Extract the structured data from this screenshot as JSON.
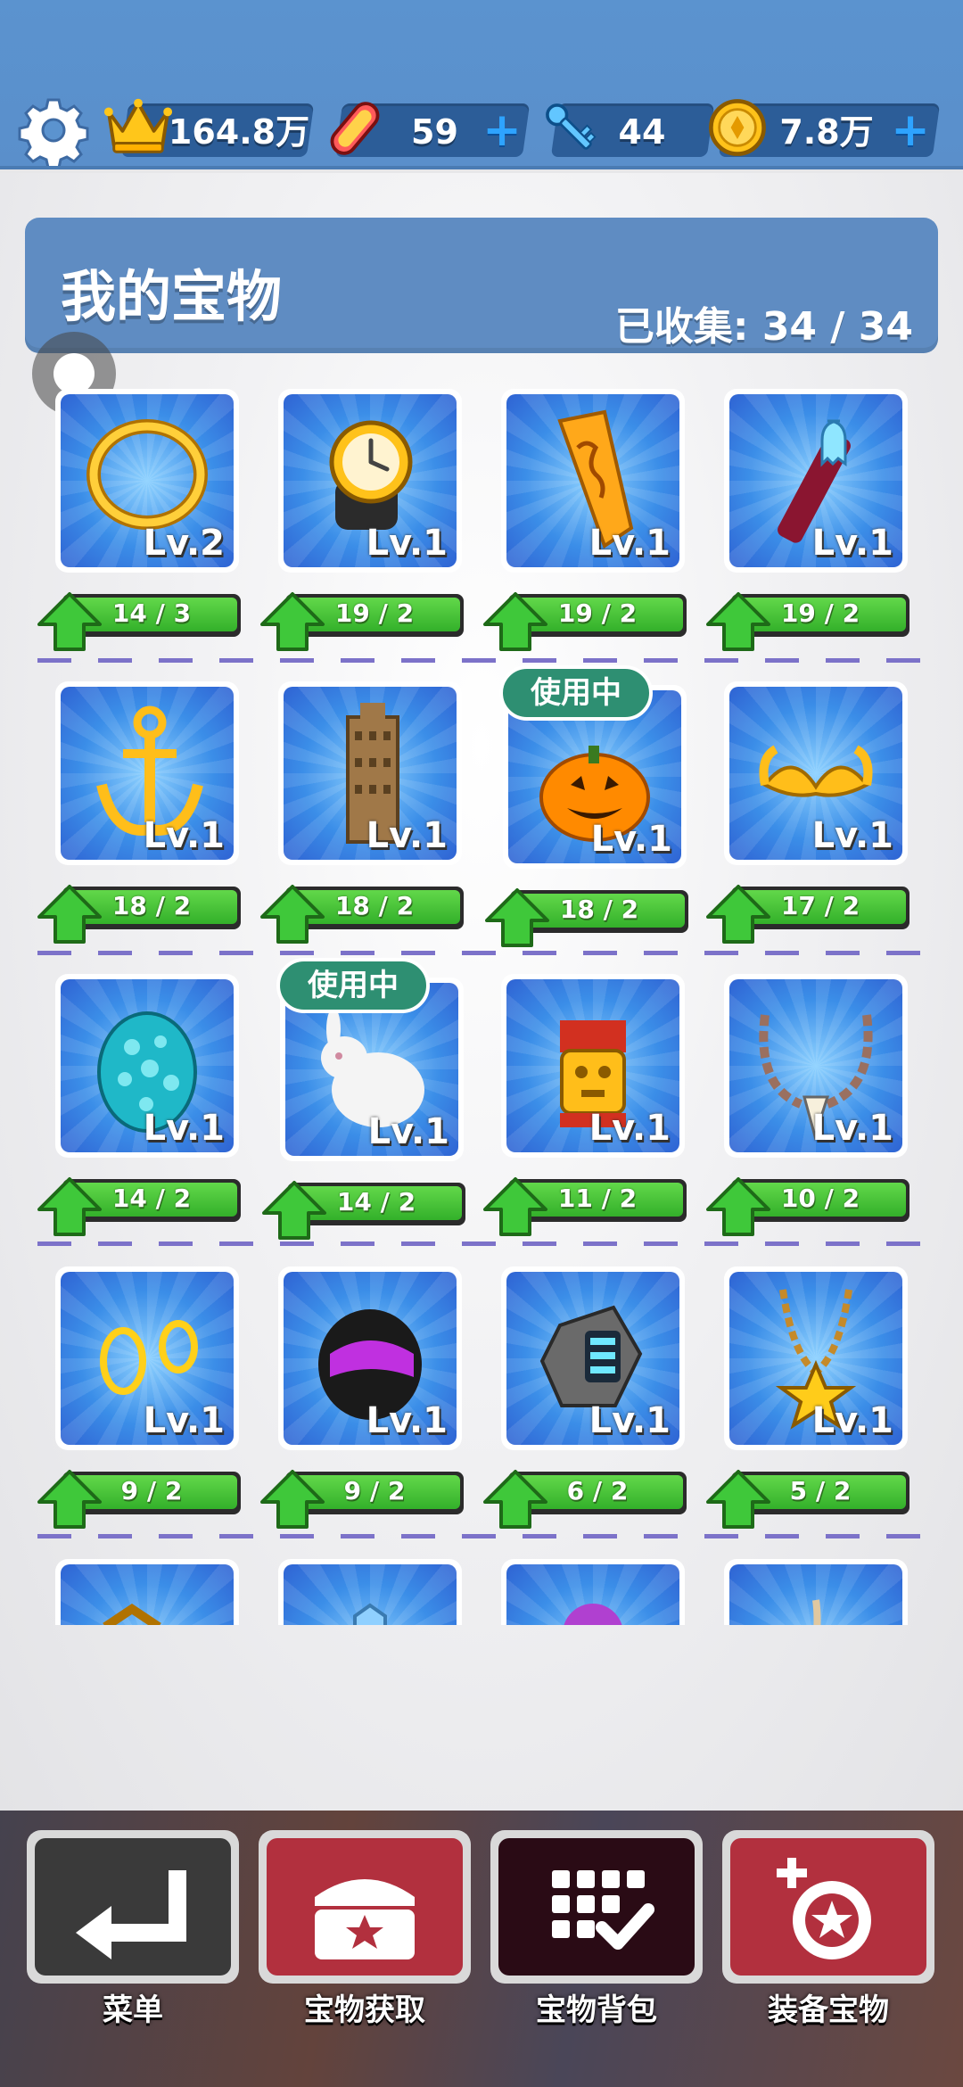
{
  "topbar": {
    "crown_value": "164.8万",
    "board_value": "59",
    "key_value": "44",
    "coin_value": "7.8万",
    "icons": [
      "gear-icon",
      "crown-icon",
      "hoverboard-icon",
      "key-icon",
      "coin-icon",
      "plus-icon"
    ]
  },
  "header": {
    "title": "我的宝物",
    "collected_label": "已收集: 34 / 34"
  },
  "in_use_label": "使用中",
  "items": [
    {
      "name": "golden-ring",
      "level": "Lv.2",
      "progress": "14 / 3"
    },
    {
      "name": "ring-watch",
      "level": "Lv.1",
      "progress": "19 / 2"
    },
    {
      "name": "golden-scroll",
      "level": "Lv.1",
      "progress": "19 / 2"
    },
    {
      "name": "ghost-wand",
      "level": "Lv.1",
      "progress": "19 / 2"
    },
    {
      "name": "golden-anchor",
      "level": "Lv.1",
      "progress": "18 / 2"
    },
    {
      "name": "skyscraper",
      "level": "Lv.1",
      "progress": "18 / 2"
    },
    {
      "name": "pumpkin",
      "level": "Lv.1",
      "progress": "18 / 2",
      "in_use": true
    },
    {
      "name": "golden-mustache",
      "level": "Lv.1",
      "progress": "17 / 2"
    },
    {
      "name": "spotted-egg",
      "level": "Lv.1",
      "progress": "14 / 2"
    },
    {
      "name": "white-rabbit",
      "level": "Lv.1",
      "progress": "14 / 2",
      "in_use": true
    },
    {
      "name": "golden-idol",
      "level": "Lv.1",
      "progress": "11 / 2"
    },
    {
      "name": "tooth-necklace",
      "level": "Lv.1",
      "progress": "10 / 2"
    },
    {
      "name": "golden-earrings",
      "level": "Lv.1",
      "progress": "9 / 2"
    },
    {
      "name": "purple-helmet",
      "level": "Lv.1",
      "progress": "9 / 2"
    },
    {
      "name": "hex-gadget",
      "level": "Lv.1",
      "progress": "6 / 2"
    },
    {
      "name": "star-necklace",
      "level": "Lv.1",
      "progress": "5 / 2"
    },
    {
      "name": "partial-item-1",
      "level": "",
      "progress": ""
    },
    {
      "name": "partial-item-2",
      "level": "",
      "progress": ""
    },
    {
      "name": "partial-item-3",
      "level": "",
      "progress": ""
    },
    {
      "name": "partial-item-4",
      "level": "",
      "progress": ""
    }
  ],
  "bottom_nav": [
    {
      "label": "菜单",
      "icon": "return-arrow-icon",
      "color": "#3a3a3a"
    },
    {
      "label": "宝物获取",
      "icon": "treasure-chest-icon",
      "color": "#b2303e"
    },
    {
      "label": "宝物背包",
      "icon": "grid-check-icon",
      "color": "#2a0b15"
    },
    {
      "label": "装备宝物",
      "icon": "equip-treasure-icon",
      "color": "#b2303e"
    }
  ]
}
